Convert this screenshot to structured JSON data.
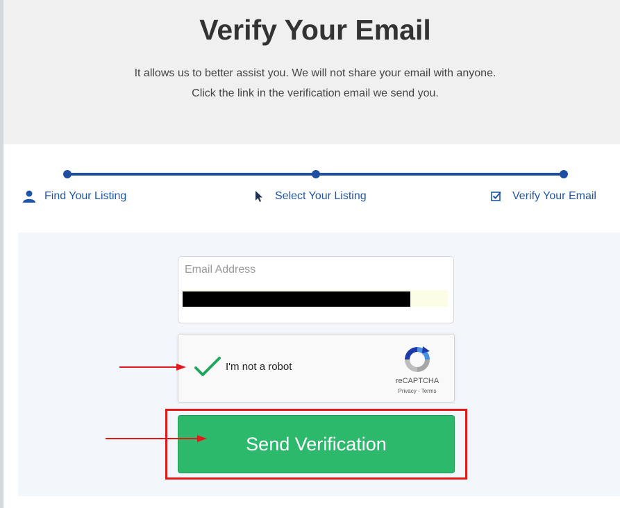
{
  "header": {
    "title": "Verify Your Email",
    "subtitle_line1": "It allows us to better assist you. We will not share your email with anyone.",
    "subtitle_line2": "Click the link in the verification email we send you."
  },
  "steps": [
    {
      "label": "Find Your Listing",
      "icon": "user-icon"
    },
    {
      "label": "Select Your Listing",
      "icon": "cursor-icon"
    },
    {
      "label": "Verify Your Email",
      "icon": "checkbox-icon"
    }
  ],
  "form": {
    "email_label": "Email Address",
    "email_value": "",
    "captcha_text": "I'm not a robot",
    "captcha_checked": true,
    "captcha_brand": "reCAPTCHA",
    "captcha_links": "Privacy - Terms",
    "submit_label": "Send Verification"
  },
  "colors": {
    "accent_blue": "#1f4fa0",
    "button_green": "#2db96c",
    "annotation_red": "#e01a1a",
    "header_bg": "#f0f0f0",
    "panel_bg": "#f3f7fc"
  }
}
